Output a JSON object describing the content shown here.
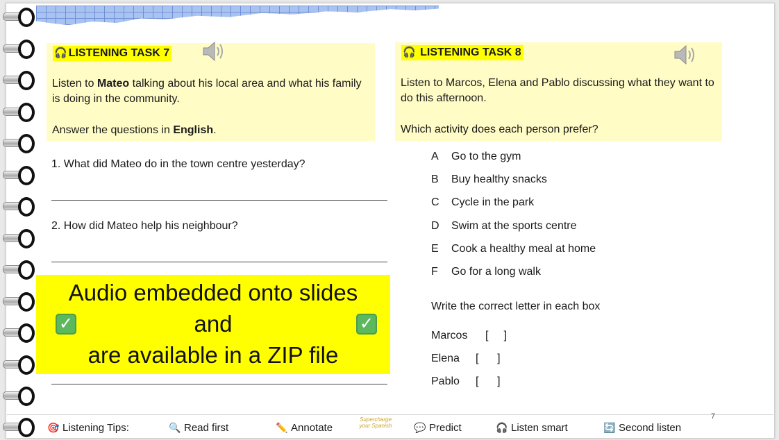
{
  "task7": {
    "title": "LISTENING TASK 7",
    "instruction_pre": "Listen to ",
    "instruction_name": "Mateo",
    "instruction_post": " talking about his local area and what his family is doing in the community.",
    "answer_pre": "Answer the questions in ",
    "answer_lang": "English",
    "answer_post": ".",
    "questions": [
      "1. What did Mateo do in the town centre yesterday?",
      "2. How did Mateo help his neighbour?"
    ]
  },
  "task8": {
    "title": "LISTENING TASK 8",
    "instruction": "Listen to Marcos, Elena and Pablo discussing what they want to do this afternoon.",
    "question": "Which activity does each person prefer?",
    "options": [
      {
        "letter": "A",
        "text": "Go to the gym"
      },
      {
        "letter": "B",
        "text": "Buy healthy snacks"
      },
      {
        "letter": "C",
        "text": "Cycle in the park"
      },
      {
        "letter": "D",
        "text": "Swim at the sports centre"
      },
      {
        "letter": "E",
        "text": "Cook a healthy meal at home"
      },
      {
        "letter": "F",
        "text": "Go for a long walk"
      }
    ],
    "write_instruction": "Write the correct letter in each box",
    "names": [
      {
        "name": "Marcos",
        "box": "[     ]"
      },
      {
        "name": "Elena",
        "box": "[      ]"
      },
      {
        "name": "Pablo",
        "box": "[      ]"
      }
    ]
  },
  "banner": {
    "line1": "Audio embedded onto slides",
    "line2": "and",
    "line3": "are available in a ZIP file",
    "check_icon": "white-check-mark-icon"
  },
  "footer": {
    "tips": [
      {
        "icon": "target-icon",
        "label": "Listening Tips:"
      },
      {
        "icon": "magnifier-icon",
        "label": "Read first"
      },
      {
        "icon": "pencil-icon",
        "label": "Annotate"
      },
      {
        "icon": "speech-bubble-icon",
        "label": "Predict"
      },
      {
        "icon": "headphones-icon",
        "label": "Listen smart"
      },
      {
        "icon": "repeat-icon",
        "label": "Second listen"
      }
    ],
    "logo_line1": "Supercharge",
    "logo_line2": "your Spanish",
    "page_number": "7"
  },
  "colors": {
    "task_box": "#fffcc6",
    "title_highlight": "#ffff00",
    "banner": "#ffff00",
    "check": "#5cb85c"
  }
}
